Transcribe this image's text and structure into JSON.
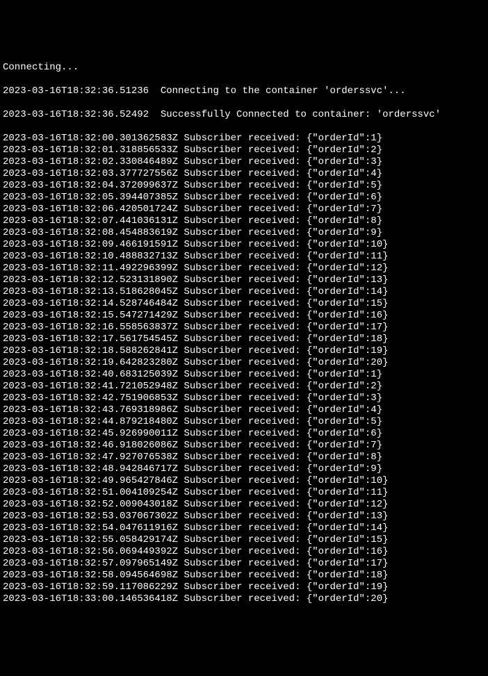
{
  "header": {
    "connecting_text": "Connecting...",
    "connect_line": "2023-03-16T18:32:36.51236  Connecting to the container 'orderssvc'...",
    "connected_line": "2023-03-16T18:32:36.52492  Successfully Connected to container: 'orderssvc'"
  },
  "logs": [
    {
      "ts": "2023-03-16T18:32:00.301362583Z",
      "msg": "Subscriber received: {\"orderId\":1}"
    },
    {
      "ts": "2023-03-16T18:32:01.318856533Z",
      "msg": "Subscriber received: {\"orderId\":2}"
    },
    {
      "ts": "2023-03-16T18:32:02.330846489Z",
      "msg": "Subscriber received: {\"orderId\":3}"
    },
    {
      "ts": "2023-03-16T18:32:03.377727556Z",
      "msg": "Subscriber received: {\"orderId\":4}"
    },
    {
      "ts": "2023-03-16T18:32:04.372099637Z",
      "msg": "Subscriber received: {\"orderId\":5}"
    },
    {
      "ts": "2023-03-16T18:32:05.394407385Z",
      "msg": "Subscriber received: {\"orderId\":6}"
    },
    {
      "ts": "2023-03-16T18:32:06.420501724Z",
      "msg": "Subscriber received: {\"orderId\":7}"
    },
    {
      "ts": "2023-03-16T18:32:07.441036131Z",
      "msg": "Subscriber received: {\"orderId\":8}"
    },
    {
      "ts": "2023-03-16T18:32:08.454883619Z",
      "msg": "Subscriber received: {\"orderId\":9}"
    },
    {
      "ts": "2023-03-16T18:32:09.466191591Z",
      "msg": "Subscriber received: {\"orderId\":10}"
    },
    {
      "ts": "2023-03-16T18:32:10.488832713Z",
      "msg": "Subscriber received: {\"orderId\":11}"
    },
    {
      "ts": "2023-03-16T18:32:11.492296399Z",
      "msg": "Subscriber received: {\"orderId\":12}"
    },
    {
      "ts": "2023-03-16T18:32:12.523131890Z",
      "msg": "Subscriber received: {\"orderId\":13}"
    },
    {
      "ts": "2023-03-16T18:32:13.518628045Z",
      "msg": "Subscriber received: {\"orderId\":14}"
    },
    {
      "ts": "2023-03-16T18:32:14.528746484Z",
      "msg": "Subscriber received: {\"orderId\":15}"
    },
    {
      "ts": "2023-03-16T18:32:15.547271429Z",
      "msg": "Subscriber received: {\"orderId\":16}"
    },
    {
      "ts": "2023-03-16T18:32:16.558563837Z",
      "msg": "Subscriber received: {\"orderId\":17}"
    },
    {
      "ts": "2023-03-16T18:32:17.561754545Z",
      "msg": "Subscriber received: {\"orderId\":18}"
    },
    {
      "ts": "2023-03-16T18:32:18.588262841Z",
      "msg": "Subscriber received: {\"orderId\":19}"
    },
    {
      "ts": "2023-03-16T18:32:19.642823280Z",
      "msg": "Subscriber received: {\"orderId\":20}"
    },
    {
      "ts": "2023-03-16T18:32:40.683125039Z",
      "msg": "Subscriber received: {\"orderId\":1}"
    },
    {
      "ts": "2023-03-16T18:32:41.721052948Z",
      "msg": "Subscriber received: {\"orderId\":2}"
    },
    {
      "ts": "2023-03-16T18:32:42.751906853Z",
      "msg": "Subscriber received: {\"orderId\":3}"
    },
    {
      "ts": "2023-03-16T18:32:43.769318986Z",
      "msg": "Subscriber received: {\"orderId\":4}"
    },
    {
      "ts": "2023-03-16T18:32:44.879218480Z",
      "msg": "Subscriber received: {\"orderId\":5}"
    },
    {
      "ts": "2023-03-16T18:32:45.926990011Z",
      "msg": "Subscriber received: {\"orderId\":6}"
    },
    {
      "ts": "2023-03-16T18:32:46.918026086Z",
      "msg": "Subscriber received: {\"orderId\":7}"
    },
    {
      "ts": "2023-03-16T18:32:47.927076538Z",
      "msg": "Subscriber received: {\"orderId\":8}"
    },
    {
      "ts": "2023-03-16T18:32:48.942846717Z",
      "msg": "Subscriber received: {\"orderId\":9}"
    },
    {
      "ts": "2023-03-16T18:32:49.965427846Z",
      "msg": "Subscriber received: {\"orderId\":10}"
    },
    {
      "ts": "2023-03-16T18:32:51.004109254Z",
      "msg": "Subscriber received: {\"orderId\":11}"
    },
    {
      "ts": "2023-03-16T18:32:52.009043018Z",
      "msg": "Subscriber received: {\"orderId\":12}"
    },
    {
      "ts": "2023-03-16T18:32:53.037067302Z",
      "msg": "Subscriber received: {\"orderId\":13}"
    },
    {
      "ts": "2023-03-16T18:32:54.047611916Z",
      "msg": "Subscriber received: {\"orderId\":14}"
    },
    {
      "ts": "2023-03-16T18:32:55.058429174Z",
      "msg": "Subscriber received: {\"orderId\":15}"
    },
    {
      "ts": "2023-03-16T18:32:56.069449392Z",
      "msg": "Subscriber received: {\"orderId\":16}"
    },
    {
      "ts": "2023-03-16T18:32:57.097965149Z",
      "msg": "Subscriber received: {\"orderId\":17}"
    },
    {
      "ts": "2023-03-16T18:32:58.094564698Z",
      "msg": "Subscriber received: {\"orderId\":18}"
    },
    {
      "ts": "2023-03-16T18:32:59.117086229Z",
      "msg": "Subscriber received: {\"orderId\":19}"
    },
    {
      "ts": "2023-03-16T18:33:00.146536418Z",
      "msg": "Subscriber received: {\"orderId\":20}"
    }
  ]
}
